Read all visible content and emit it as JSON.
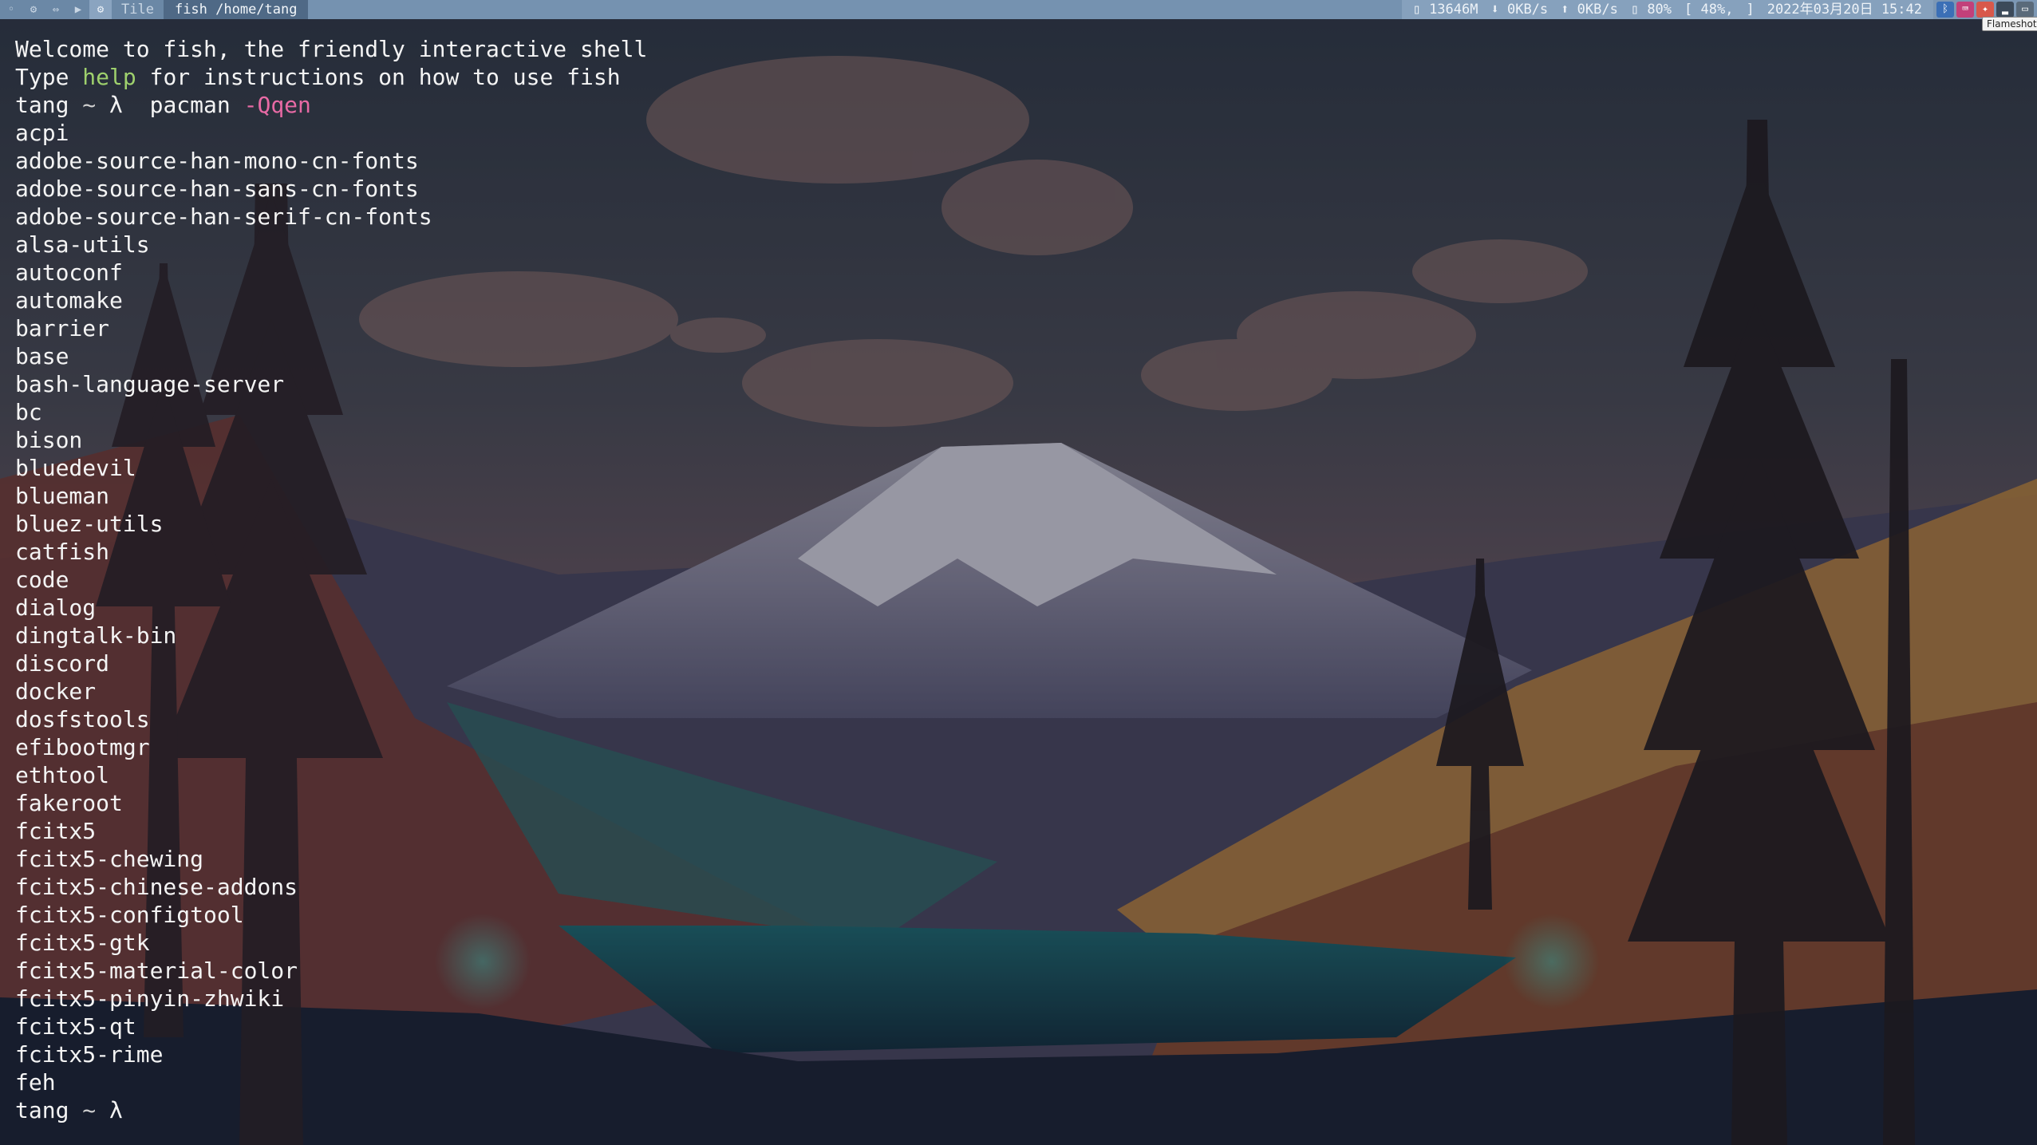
{
  "topbar": {
    "left_icons": [
      "circle-icon",
      "gear-icon",
      "link-icon",
      "play-icon",
      "active-tag-icon"
    ],
    "layout_label": "Tile",
    "window_title": "fish /home/tang",
    "status": {
      "memory": "13646M",
      "download": "0KB/s",
      "upload": "0KB/s",
      "volume": "80%",
      "battery": "[ 48%,",
      "bracket": "]",
      "datetime": "2022年03月20日 15:42"
    },
    "tray_icons": [
      "bluetooth-icon",
      "fcitx-icon",
      "flameshot-icon",
      "network-icon",
      "display-icon"
    ],
    "tooltip": "Flameshot"
  },
  "terminal": {
    "greeting_line": "Welcome to fish, the friendly interactive shell",
    "help_line": {
      "prefix": "Type ",
      "keyword": "help",
      "suffix": " for instructions on how to use fish"
    },
    "prompt": {
      "user": "tang",
      "dir": "~",
      "symbol": "λ"
    },
    "command": {
      "name": "pacman",
      "flag": "-Qqen"
    },
    "packages": [
      "acpi",
      "adobe-source-han-mono-cn-fonts",
      "adobe-source-han-sans-cn-fonts",
      "adobe-source-han-serif-cn-fonts",
      "alsa-utils",
      "autoconf",
      "automake",
      "barrier",
      "base",
      "bash-language-server",
      "bc",
      "bison",
      "bluedevil",
      "blueman",
      "bluez-utils",
      "catfish",
      "code",
      "dialog",
      "dingtalk-bin",
      "discord",
      "docker",
      "dosfstools",
      "efibootmgr",
      "ethtool",
      "fakeroot",
      "fcitx5",
      "fcitx5-chewing",
      "fcitx5-chinese-addons",
      "fcitx5-configtool",
      "fcitx5-gtk",
      "fcitx5-material-color",
      "fcitx5-pinyin-zhwiki",
      "fcitx5-qt",
      "fcitx5-rime",
      "feh"
    ]
  },
  "colors": {
    "topbar": "#6b88a6",
    "help_keyword": "#9ed06d",
    "flag": "#e86aa5",
    "text": "#f4f4f4"
  }
}
